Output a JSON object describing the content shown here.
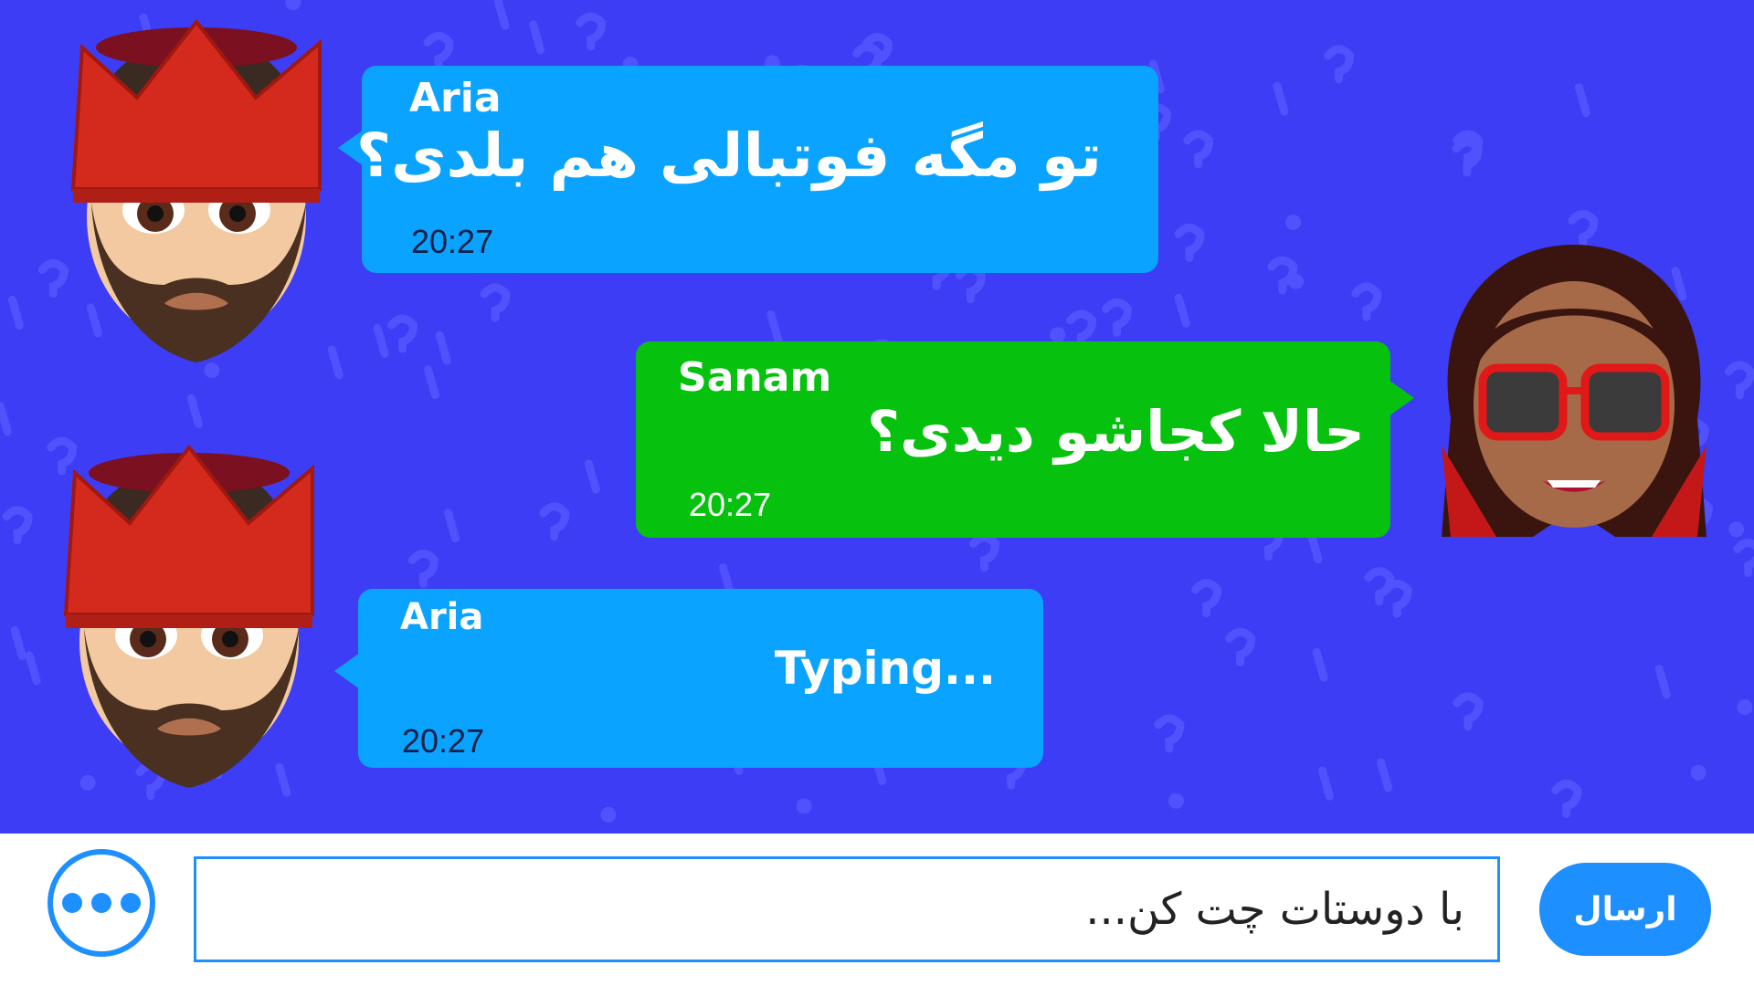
{
  "colors": {
    "background": "#3d3df5",
    "incoming_bubble": "#0aa3ff",
    "outgoing_bubble": "#06c20e",
    "accent": "#1e8fff",
    "timestamp_dark": "#10204a"
  },
  "messages": [
    {
      "sender": "Aria",
      "text": "تو مگه فوتبالی هم بلدی؟",
      "time": "20:27",
      "avatar": "aria-avatar"
    },
    {
      "sender": "Sanam",
      "text": "حالا کجاشو دیدی؟",
      "time": "20:27",
      "avatar": "sanam-avatar"
    },
    {
      "sender": "Aria",
      "text": "Typing...",
      "time": "20:27",
      "avatar": "aria-avatar"
    }
  ],
  "composer": {
    "more_icon": "more-dots-icon",
    "placeholder": "با دوستات چت کن...",
    "send_label": "ارسال"
  }
}
